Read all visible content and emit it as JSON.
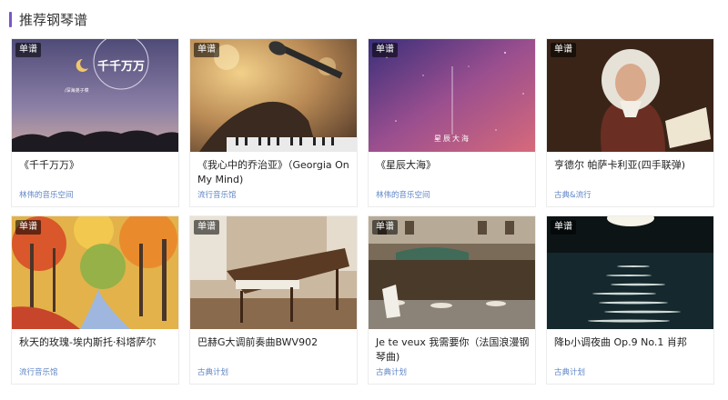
{
  "section": {
    "title": "推荐钢琴谱"
  },
  "badge_label": "单谱",
  "cards": [
    {
      "title": "《千千万万》",
      "tag": "林伟的音乐空间",
      "cover_text": "千千万万",
      "cover_subtext": "/深海弟子菜",
      "icon": "cover-art-night-sky"
    },
    {
      "title": "《我心中的乔治亚》（Georgia On My Mind)",
      "tag": "流行音乐馆",
      "icon": "cover-art-microphone"
    },
    {
      "title": "《星辰大海》",
      "tag": "林伟的音乐空间",
      "cover_text": "星辰大海",
      "icon": "cover-art-galaxy"
    },
    {
      "title": "亨德尔 帕萨卡利亚(四手联弹)",
      "tag": "古典&流行",
      "icon": "cover-art-portrait"
    },
    {
      "title": "秋天的玫瑰-埃内斯托·科塔萨尔",
      "tag": "流行音乐馆",
      "icon": "cover-art-autumn-path"
    },
    {
      "title": "巴赫G大调前奏曲BWV902",
      "tag": "古典计划",
      "icon": "cover-art-harpsichord"
    },
    {
      "title": "Je te veux 我需要你（法国浪漫钢琴曲)",
      "tag": "古典计划",
      "icon": "cover-art-paris-cafe"
    },
    {
      "title": "降b小调夜曲 Op.9 No.1 肖邦",
      "tag": "古典计划",
      "icon": "cover-art-moon-sea"
    }
  ],
  "colors": {
    "accent": "#7a57c9",
    "tag": "#5f86c6"
  }
}
